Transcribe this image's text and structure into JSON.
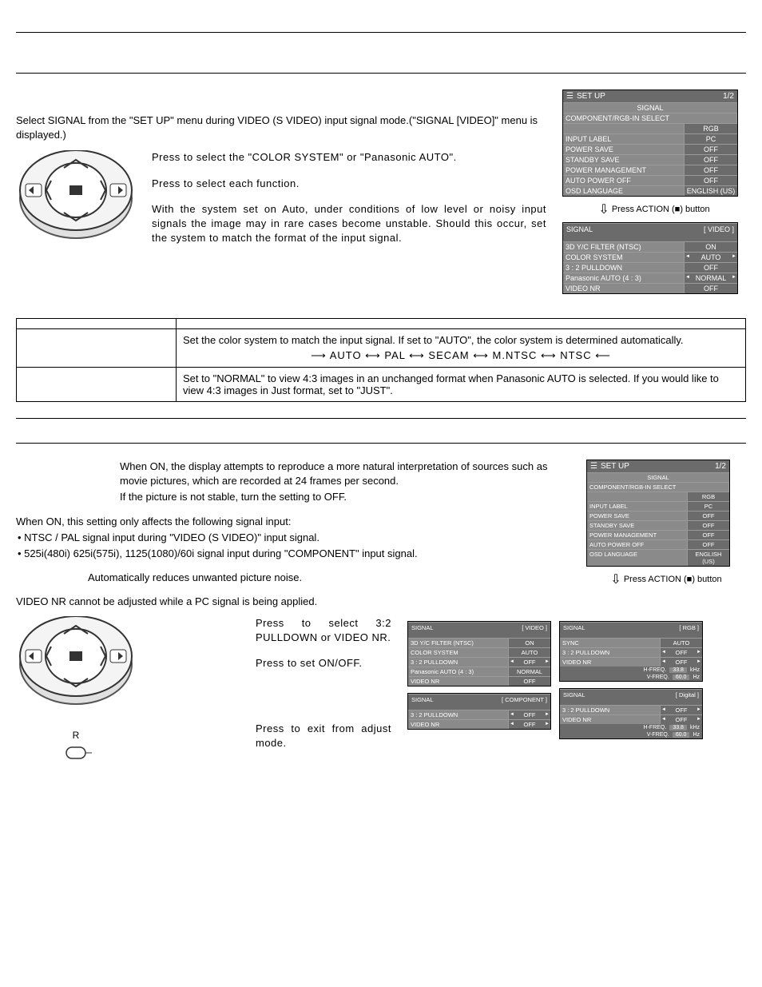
{
  "intro": {
    "p1": "Select SIGNAL from the \"SET UP\" menu during VIDEO (S VIDEO) input signal mode.(\"SIGNAL [VIDEO]\" menu is displayed.)"
  },
  "instructions": {
    "p1": "Press to select the \"COLOR SYSTEM\" or \"Panasonic AUTO\".",
    "p2": "Press to select each function.",
    "p3": "With the system set on Auto, under conditions of low level or noisy input signals the image may in rare cases become unstable. Should this occur, set the system to match the format of the input signal."
  },
  "setup_menu": {
    "title": "SET UP",
    "page": "1/2",
    "signal_header": "SIGNAL",
    "component_label": "COMPONENT/RGB-IN SELECT",
    "rows": [
      {
        "label": "",
        "value": "RGB"
      },
      {
        "label": "INPUT LABEL",
        "value": "PC"
      },
      {
        "label": "POWER SAVE",
        "value": "OFF"
      },
      {
        "label": "STANDBY SAVE",
        "value": "OFF"
      },
      {
        "label": "POWER MANAGEMENT",
        "value": "OFF"
      },
      {
        "label": "AUTO POWER OFF",
        "value": "OFF"
      },
      {
        "label": "OSD LANGUAGE",
        "value": "ENGLISH (US)"
      }
    ]
  },
  "press_action": "Press ACTION (■) button",
  "signal_video": {
    "title": "SIGNAL",
    "mode": "[ VIDEO ]",
    "rows": [
      {
        "label": "3D Y/C FILTER (NTSC)",
        "value": "ON",
        "arrows": false
      },
      {
        "label": "COLOR SYSTEM",
        "value": "AUTO",
        "arrows": true
      },
      {
        "label": "3 : 2 PULLDOWN",
        "value": "OFF",
        "arrows": false
      },
      {
        "label": "Panasonic AUTO (4 : 3)",
        "value": "NORMAL",
        "arrows": true
      },
      {
        "label": "VIDEO NR",
        "value": "OFF",
        "arrows": false
      }
    ]
  },
  "table_rows": [
    {
      "label": "",
      "body": "Set the color system to match the input signal. If set to \"AUTO\", the color system is determined automatically.",
      "cycle": "AUTO ⟷ PAL ⟷ SECAM ⟷ M.NTSC ⟷ NTSC"
    },
    {
      "label": "",
      "body": "Set to \"NORMAL\" to view 4:3 images in an unchanged format when Panasonic AUTO is selected. If you would like to view 4:3 images in Just format, set to \"JUST\"."
    }
  ],
  "section2": {
    "p1": "When ON, the display attempts to reproduce a more natural interpretation of sources such as movie pictures, which are recorded at 24 frames per second.",
    "p2": "If the picture is not stable, turn the setting to OFF.",
    "p3": "When ON, this setting only affects the following signal input:",
    "b1": "• NTSC / PAL signal input during \"VIDEO (S VIDEO)\" input signal.",
    "b2": "• 525i(480i) 625i(575i), 1125(1080)/60i signal input during \"COMPONENT\" input signal.",
    "p4": "Automatically reduces unwanted picture noise.",
    "p5": "VIDEO NR cannot be adjusted while a PC signal is being applied."
  },
  "instructions2": {
    "p1": "Press to select 3:2 PULLDOWN or VIDEO NR.",
    "p2": "Press to set ON/OFF.",
    "p3": "Press to exit from adjust mode.",
    "r_label": "R"
  },
  "signal_component": {
    "title": "SIGNAL",
    "mode": "[ COMPONENT ]",
    "rows": [
      {
        "label": "3 : 2 PULLDOWN",
        "value": "OFF",
        "arrows": true
      },
      {
        "label": "VIDEO NR",
        "value": "OFF",
        "arrows": true
      }
    ]
  },
  "signal_rgb": {
    "title": "SIGNAL",
    "mode": "[ RGB ]",
    "rows": [
      {
        "label": "SYNC",
        "value": "AUTO",
        "arrows": false
      },
      {
        "label": "3 : 2 PULLDOWN",
        "value": "OFF",
        "arrows": true
      },
      {
        "label": "VIDEO NR",
        "value": "OFF",
        "arrows": true
      }
    ],
    "hfreq_label": "H-FREQ.",
    "hfreq": "33.8",
    "hunit": "kHz",
    "vfreq_label": "V-FREQ.",
    "vfreq": "60.0",
    "vunit": "Hz"
  },
  "signal_digital": {
    "title": "SIGNAL",
    "mode": "[ Digital ]",
    "rows": [
      {
        "label": "3 : 2 PULLDOWN",
        "value": "OFF",
        "arrows": true
      },
      {
        "label": "VIDEO NR",
        "value": "OFF",
        "arrows": true
      }
    ],
    "hfreq_label": "H-FREQ.",
    "hfreq": "33.8",
    "hunit": "kHz",
    "vfreq_label": "V-FREQ.",
    "vfreq": "60.0",
    "vunit": "Hz"
  }
}
